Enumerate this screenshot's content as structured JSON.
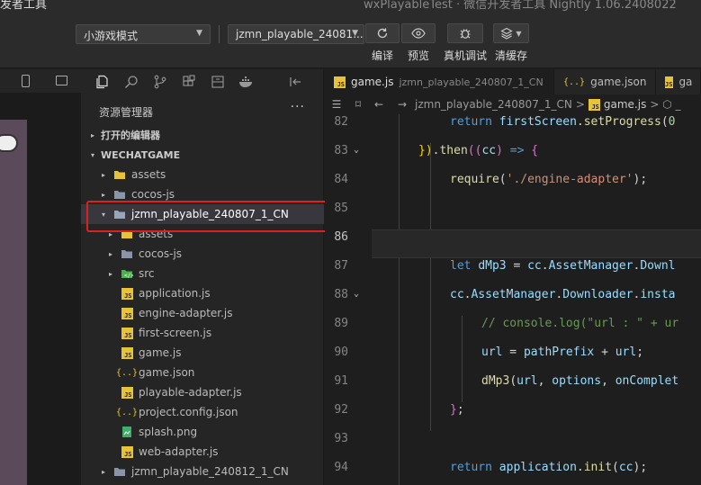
{
  "window": {
    "app_title": "发者工具",
    "title": "wxPlayableTest · 微信开发者工具 Nightly 1.06.2408022"
  },
  "toolbar": {
    "mode_select": "小游戏模式",
    "project_select": "jzmn_playable_24081...",
    "compile_label": "编译",
    "preview_label": "预览",
    "remote_debug_label": "真机调试",
    "clear_cache_label": "清缓存"
  },
  "explorer": {
    "header": "资源管理器",
    "more": "···",
    "open_editors": "打开的编辑器",
    "root": "WECHATGAME",
    "items": [
      {
        "label": "assets",
        "depth": 1,
        "type": "folder-yellow",
        "twisty": "▸"
      },
      {
        "label": "cocos-js",
        "depth": 1,
        "type": "folder",
        "twisty": "▸"
      },
      {
        "label": "jzmn_playable_240807_1_CN",
        "depth": 1,
        "type": "folder-open",
        "twisty": "▾",
        "selected": true
      },
      {
        "label": "assets",
        "depth": 2,
        "type": "folder-yellow",
        "twisty": "▸"
      },
      {
        "label": "cocos-js",
        "depth": 2,
        "type": "folder",
        "twisty": "▸"
      },
      {
        "label": "src",
        "depth": 2,
        "type": "folder-green",
        "twisty": "▸"
      },
      {
        "label": "application.js",
        "depth": 2,
        "type": "js"
      },
      {
        "label": "engine-adapter.js",
        "depth": 2,
        "type": "js"
      },
      {
        "label": "first-screen.js",
        "depth": 2,
        "type": "js"
      },
      {
        "label": "game.js",
        "depth": 2,
        "type": "js"
      },
      {
        "label": "game.json",
        "depth": 2,
        "type": "json"
      },
      {
        "label": "playable-adapter.js",
        "depth": 2,
        "type": "js"
      },
      {
        "label": "project.config.json",
        "depth": 2,
        "type": "json"
      },
      {
        "label": "splash.png",
        "depth": 2,
        "type": "png"
      },
      {
        "label": "web-adapter.js",
        "depth": 2,
        "type": "js"
      },
      {
        "label": "jzmn_playable_240812_1_CN",
        "depth": 1,
        "type": "folder",
        "twisty": "▸"
      }
    ]
  },
  "editor": {
    "tabs": [
      {
        "icon": "JS",
        "label": "game.js",
        "path": "jzmn_playable_240807_1_CN"
      },
      {
        "icon": "{..}",
        "label": "game.json",
        "path": ""
      },
      {
        "icon": "JS",
        "label": "ga",
        "path": ""
      }
    ],
    "breadcrumb": {
      "folder": "jzmn_playable_240807_1_CN",
      "sep": ">",
      "file": "game.js",
      "tail": "> ⬡ _"
    },
    "lines": [
      {
        "num": "82",
        "fold": false,
        "indent": 2,
        "parts": [
          [
            "k",
            "return "
          ],
          [
            "v",
            "firstScreen"
          ],
          [
            "p",
            "."
          ],
          [
            "f",
            "setProgress"
          ],
          [
            "p",
            "("
          ],
          [
            "n",
            "0"
          ]
        ]
      },
      {
        "num": "83",
        "fold": true,
        "indent": 1,
        "parts": [
          [
            "y",
            "})"
          ],
          [
            "p",
            "."
          ],
          [
            "f",
            "then"
          ],
          [
            "m",
            "(("
          ],
          [
            "v",
            "cc"
          ],
          [
            "m",
            ")"
          ],
          [
            "p",
            " "
          ],
          [
            "k",
            "=>"
          ],
          [
            "p",
            " "
          ],
          [
            "m",
            "{"
          ]
        ]
      },
      {
        "num": "84",
        "fold": false,
        "indent": 2,
        "parts": [
          [
            "f",
            "require"
          ],
          [
            "p",
            "("
          ],
          [
            "s",
            "'./engine-adapter'"
          ],
          [
            "p",
            ");"
          ]
        ]
      },
      {
        "num": "85",
        "fold": false,
        "indent": 0,
        "parts": []
      },
      {
        "num": "86",
        "fold": false,
        "indent": 0,
        "parts": [],
        "current": true
      },
      {
        "num": "87",
        "fold": false,
        "indent": 2,
        "parts": [
          [
            "k",
            "let "
          ],
          [
            "v",
            "dMp3"
          ],
          [
            "p",
            " = "
          ],
          [
            "v",
            "cc"
          ],
          [
            "p",
            "."
          ],
          [
            "v",
            "AssetManager"
          ],
          [
            "p",
            "."
          ],
          [
            "v",
            "Downl"
          ]
        ]
      },
      {
        "num": "88",
        "fold": true,
        "indent": 2,
        "parts": [
          [
            "v",
            "cc"
          ],
          [
            "p",
            "."
          ],
          [
            "v",
            "AssetManager"
          ],
          [
            "p",
            "."
          ],
          [
            "v",
            "Downloader"
          ],
          [
            "p",
            "."
          ],
          [
            "v",
            "insta"
          ]
        ]
      },
      {
        "num": "89",
        "fold": false,
        "indent": 3,
        "parts": [
          [
            "c",
            "// console.log(\"url : \" + ur"
          ]
        ]
      },
      {
        "num": "90",
        "fold": false,
        "indent": 3,
        "parts": [
          [
            "v",
            "url"
          ],
          [
            "p",
            " = "
          ],
          [
            "v",
            "pathPrefix"
          ],
          [
            "p",
            " + "
          ],
          [
            "v",
            "url"
          ],
          [
            "p",
            ";"
          ]
        ]
      },
      {
        "num": "91",
        "fold": false,
        "indent": 3,
        "parts": [
          [
            "f",
            "dMp3"
          ],
          [
            "p",
            "("
          ],
          [
            "v",
            "url"
          ],
          [
            "p",
            ", "
          ],
          [
            "v",
            "options"
          ],
          [
            "p",
            ", "
          ],
          [
            "v",
            "onComplet"
          ]
        ]
      },
      {
        "num": "92",
        "fold": false,
        "indent": 2,
        "parts": [
          [
            "m",
            "}"
          ],
          [
            "p",
            ";"
          ]
        ]
      },
      {
        "num": "93",
        "fold": false,
        "indent": 0,
        "parts": []
      },
      {
        "num": "94",
        "fold": false,
        "indent": 2,
        "parts": [
          [
            "k",
            "return "
          ],
          [
            "v",
            "application"
          ],
          [
            "p",
            "."
          ],
          [
            "f",
            "init"
          ],
          [
            "p",
            "("
          ],
          [
            "v",
            "cc"
          ],
          [
            "p",
            ");"
          ]
        ]
      }
    ]
  },
  "colors": {
    "accent_red": "#e02020",
    "js_icon": "#e8c33a"
  }
}
